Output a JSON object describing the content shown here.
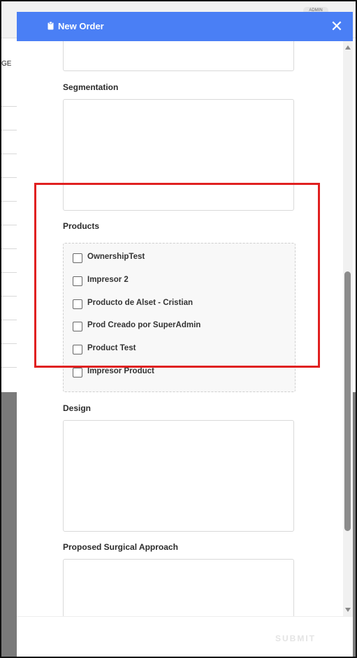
{
  "background": {
    "column_header": "GE",
    "badge": "ADMIN"
  },
  "modal": {
    "title": "New Order",
    "close_label": "✕",
    "fields": {
      "segmentation_label": "Segmentation",
      "products_label": "Products",
      "design_label": "Design",
      "surgical_label": "Proposed Surgical Approach"
    },
    "products": [
      {
        "label": "OwnershipTest",
        "checked": false
      },
      {
        "label": "Impresor 2",
        "checked": false
      },
      {
        "label": "Producto de Alset - Cristian",
        "checked": false
      },
      {
        "label": "Prod Creado por SuperAdmin",
        "checked": false
      },
      {
        "label": "Product Test",
        "checked": false
      },
      {
        "label": "Impresor Product",
        "checked": false
      }
    ],
    "submit_label": "SUBMIT"
  },
  "colors": {
    "header": "#4a7ff5",
    "highlight": "#e02020"
  }
}
